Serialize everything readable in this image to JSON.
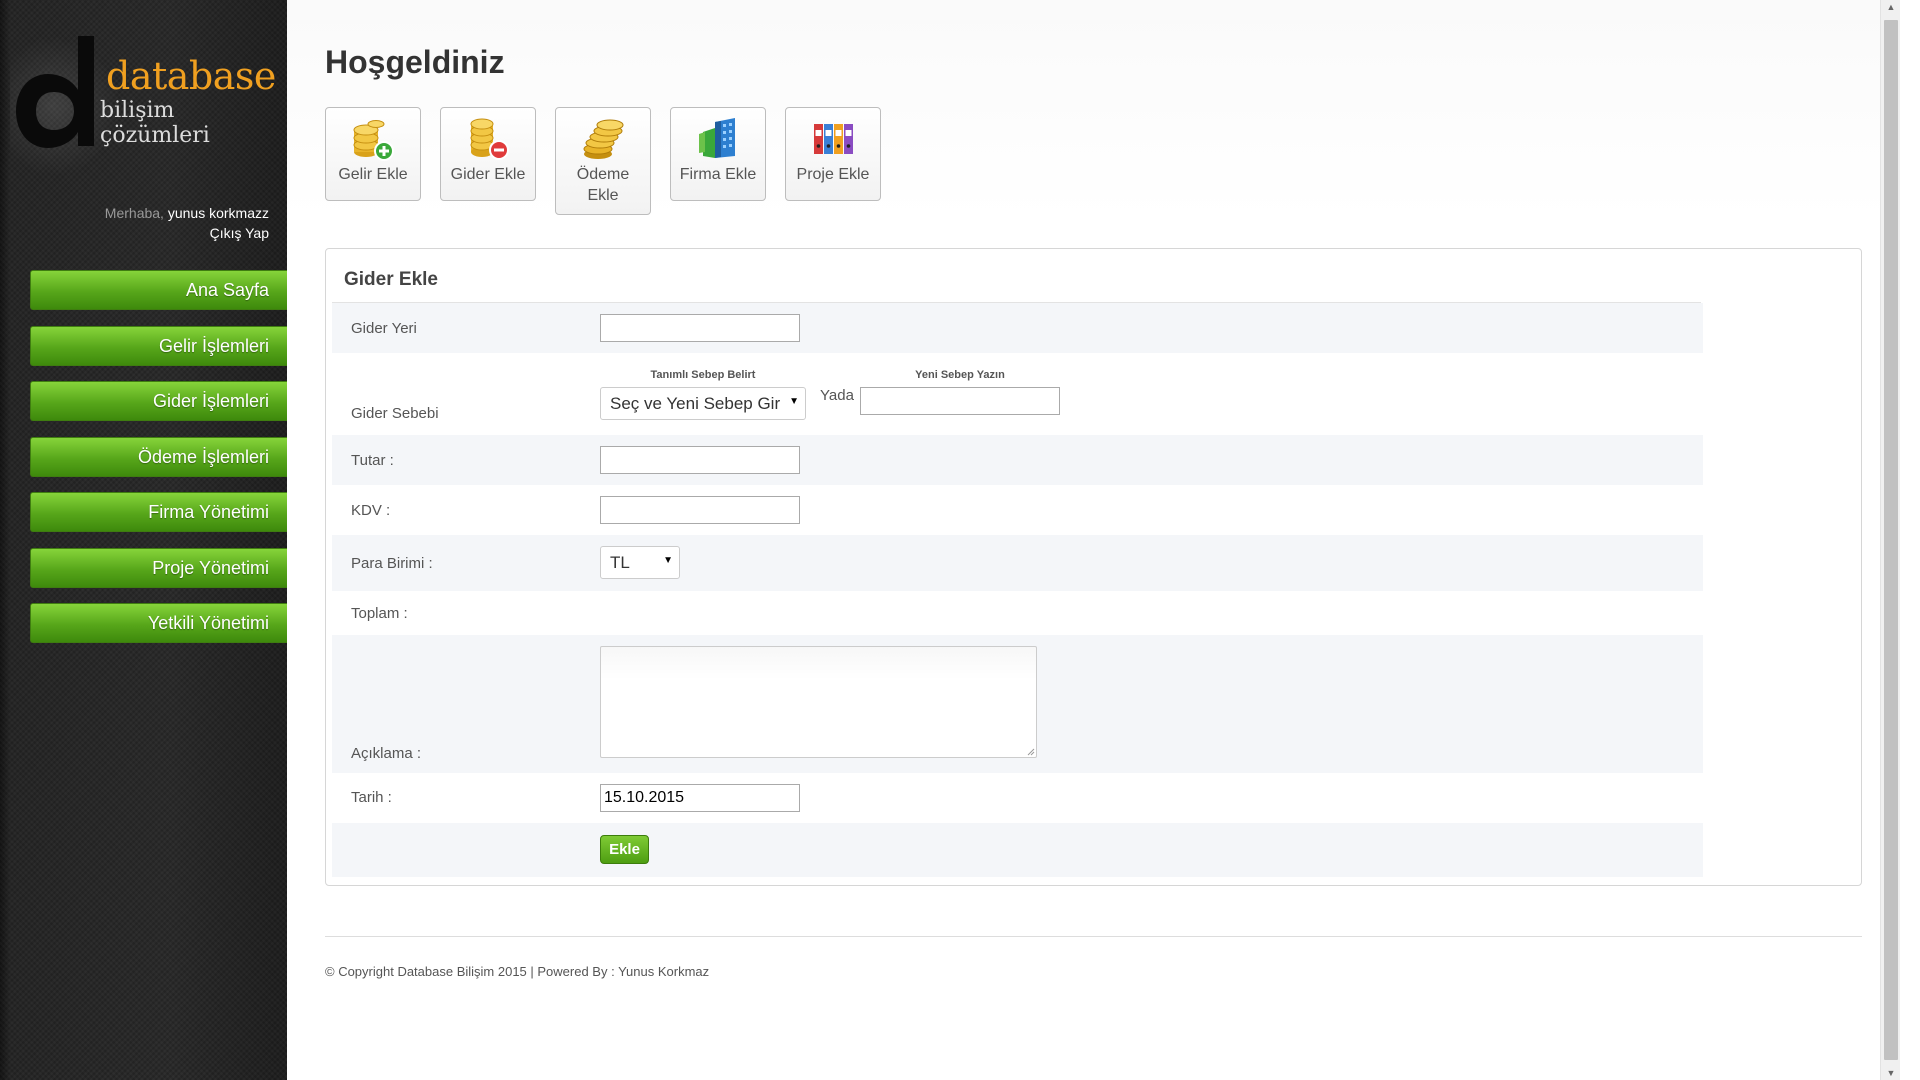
{
  "brand": {
    "word1": "database",
    "word2": "bilişim çözümleri",
    "accent": "#f0a020"
  },
  "user": {
    "greeting": "Merhaba,",
    "name": "yunus korkmazz",
    "logout": "Çıkış Yap"
  },
  "sidebar": {
    "items": [
      {
        "label": "Ana Sayfa"
      },
      {
        "label": "Gelir İşlemleri"
      },
      {
        "label": "Gider İşlemleri"
      },
      {
        "label": "Ödeme İşlemleri"
      },
      {
        "label": "Firma Yönetimi"
      },
      {
        "label": "Proje Yönetimi"
      },
      {
        "label": "Yetkili Yönetimi"
      }
    ],
    "color": "#5aac1c"
  },
  "page": {
    "title": "Hoşgeldiniz"
  },
  "quick_actions": [
    {
      "label": "Gelir Ekle",
      "icon": "coins-plus-icon"
    },
    {
      "label": "Gider Ekle",
      "icon": "coins-minus-icon"
    },
    {
      "label": "Ödeme Ekle",
      "icon": "coin-stack-icon"
    },
    {
      "label": "Firma Ekle",
      "icon": "building-icon"
    },
    {
      "label": "Proje Ekle",
      "icon": "binders-icon"
    }
  ],
  "form": {
    "title": "Gider Ekle",
    "gider_yeri": {
      "label": "Gider Yeri",
      "value": ""
    },
    "gider_sebebi": {
      "label": "Gider Sebebi",
      "defined_header": "Tanımlı Sebep Belirt",
      "select_value": "Seç ve Yeni Sebep Gir",
      "or_text": "Yada",
      "new_header": "Yeni Sebep Yazın",
      "new_value": ""
    },
    "tutar": {
      "label": "Tutar :",
      "value": ""
    },
    "kdv": {
      "label": "KDV :",
      "value": ""
    },
    "para_birimi": {
      "label": "Para Birimi :",
      "value": "TL"
    },
    "toplam": {
      "label": "Toplam :"
    },
    "aciklama": {
      "label": "Açıklama :",
      "value": ""
    },
    "tarih": {
      "label": "Tarih :",
      "value": "15.10.2015"
    },
    "submit": "Ekle"
  },
  "footer": {
    "text": "© Copyright Database Bilişim 2015 | Powered By : Yunus Korkmaz"
  }
}
